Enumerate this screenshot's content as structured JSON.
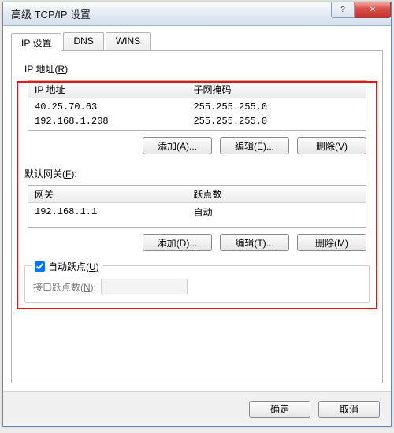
{
  "window": {
    "title": "高级 TCP/IP 设置",
    "help_glyph": "?",
    "close_glyph": "✕"
  },
  "tabs": {
    "ip": "IP 设置",
    "dns": "DNS",
    "wins": "WINS"
  },
  "ip_section": {
    "label_prefix": "IP 地址(",
    "label_key": "R",
    "label_suffix": ")",
    "header_ip": "IP 地址",
    "header_mask": "子网掩码",
    "rows": [
      {
        "ip": "40.25.70.63",
        "mask": "255.255.255.0"
      },
      {
        "ip": "192.168.1.208",
        "mask": "255.255.255.0"
      }
    ],
    "add": "添加(A)...",
    "edit": "编辑(E)...",
    "del": "删除(V)"
  },
  "gw_section": {
    "label_prefix": "默认网关(",
    "label_key": "F",
    "label_suffix": "):",
    "header_gw": "网关",
    "header_metric": "跃点数",
    "rows": [
      {
        "gw": "192.168.1.1",
        "metric": "自动"
      }
    ],
    "add": "添加(D)...",
    "edit": "编辑(T)...",
    "del": "删除(M)"
  },
  "auto_metric": {
    "checkbox_prefix": "自动跃点(",
    "checkbox_key": "U",
    "checkbox_suffix": ")",
    "checked": true,
    "metric_label_prefix": "接口跃点数(",
    "metric_label_key": "N",
    "metric_label_suffix": "):",
    "metric_value": ""
  },
  "dialog": {
    "ok": "确定",
    "cancel": "取消"
  }
}
